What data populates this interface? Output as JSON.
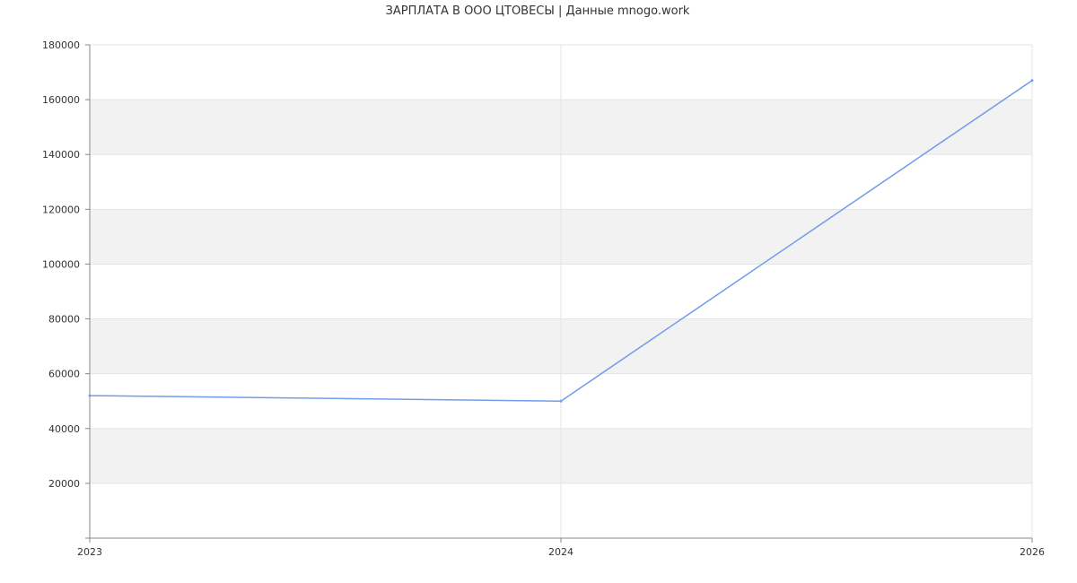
{
  "chart_data": {
    "type": "line",
    "title": "ЗАРПЛАТА В ООО ЦТОВЕСЫ | Данные mnogo.work",
    "xlabel": "",
    "ylabel": "",
    "x": [
      "2023",
      "2024",
      "2026"
    ],
    "x_positions": [
      2023,
      2024,
      2025
    ],
    "series": [
      {
        "values": [
          52000,
          50000,
          167000
        ]
      }
    ],
    "ylim": [
      0,
      180000
    ],
    "yticks": [
      20000,
      40000,
      60000,
      80000,
      100000,
      120000,
      140000,
      160000,
      180000
    ],
    "grid": "horizontal bands and vertical lines",
    "colors": {
      "line": "#6f9ded",
      "band": "#f2f2f2",
      "grid": "#e5e5e5",
      "axis": "#888888"
    }
  }
}
